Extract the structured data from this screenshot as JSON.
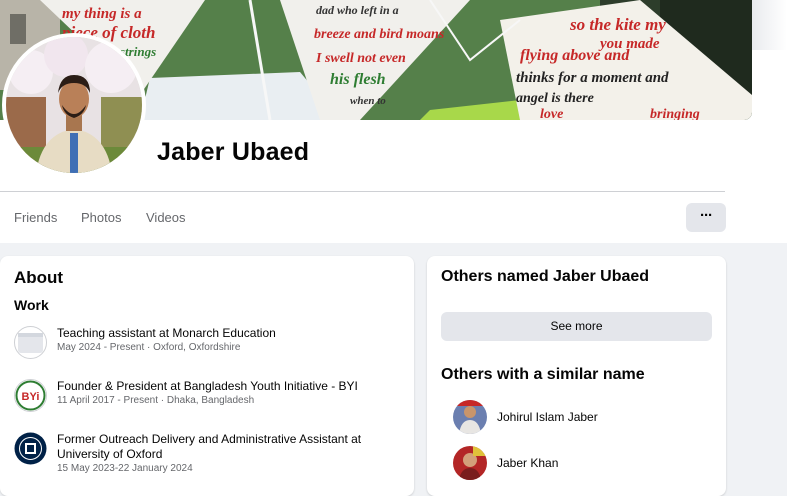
{
  "profile": {
    "name": "Jaber Ubaed",
    "cover_text": [
      "my thing is a",
      "piece of cloth",
      "strings",
      "dad who left in a",
      "breeze and bird moans",
      "I swell not even",
      "his flesh",
      "when to",
      "so the kite my",
      "you made",
      "flying above and",
      "thinks for a moment and",
      "angel is there",
      "love",
      "bringing"
    ]
  },
  "tabs": [
    "Friends",
    "Photos",
    "Videos"
  ],
  "more_button": "···",
  "about": {
    "title": "About",
    "work_heading": "Work",
    "items": [
      {
        "role": "Teaching assistant at ",
        "org": "Monarch Education",
        "meta": "May 2024 - Present · Oxford, Oxfordshire"
      },
      {
        "role": "Founder & President at ",
        "org": "Bangladesh Youth Initiative - BYI",
        "meta": "11 April 2017 - Present · Dhaka, Bangladesh"
      },
      {
        "role": "Former Outreach Delivery and Administrative Assistant at",
        "org": "University of Oxford",
        "meta": "15 May 2023-22 January 2024"
      }
    ],
    "icon_text_byi": "BYi"
  },
  "others": {
    "title": "Others named Jaber Ubaed",
    "see_more": "See more",
    "similar_title": "Others with a similar name",
    "people": [
      "Johirul Islam Jaber",
      "Jaber Khan"
    ]
  },
  "colors": {
    "cover_red": "#c62828",
    "cover_flag": "#f1f0ec",
    "accent_green": "#7ac043"
  }
}
